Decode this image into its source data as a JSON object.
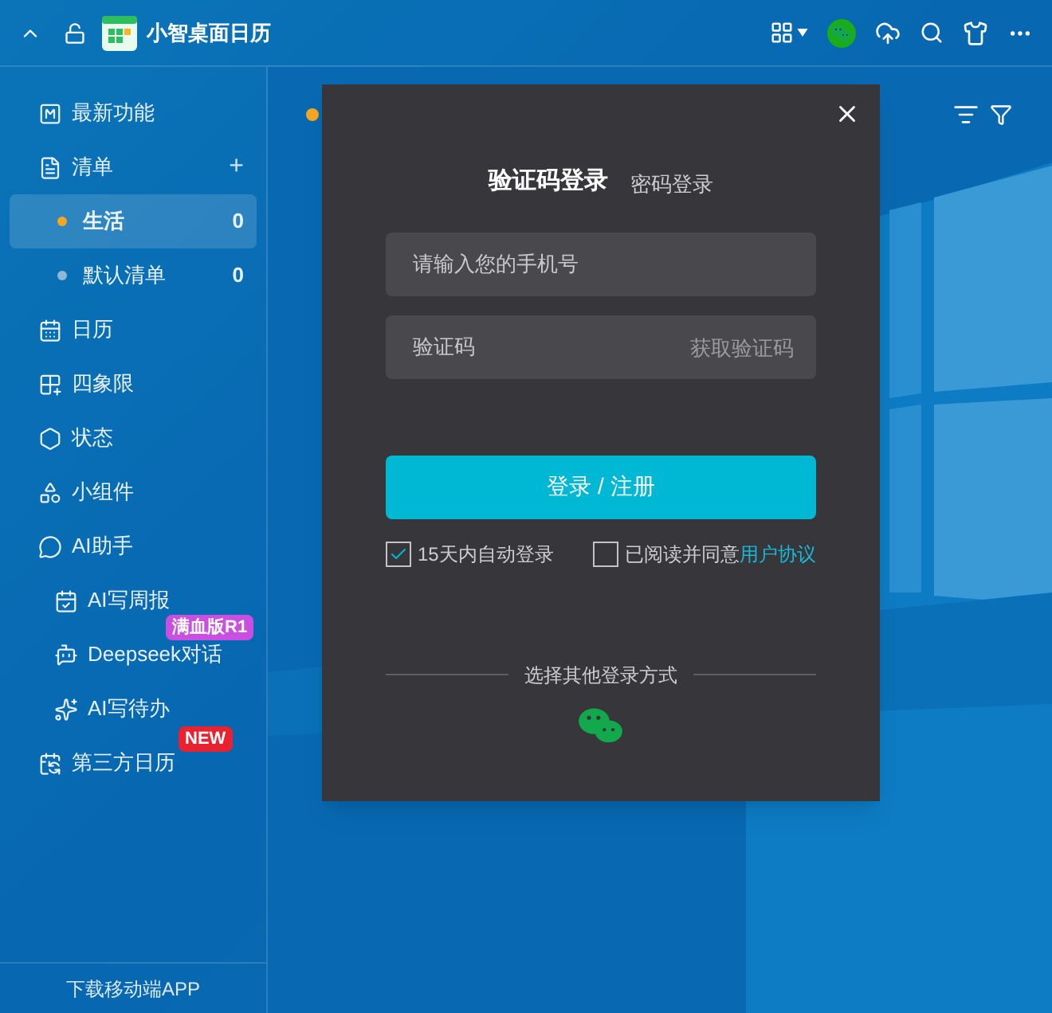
{
  "app": {
    "title": "小智桌面日历"
  },
  "sidebar": {
    "items": [
      {
        "kind": "item",
        "label": "最新功能"
      },
      {
        "kind": "group",
        "label": "清单",
        "add": "+",
        "children": [
          {
            "kind": "list",
            "label": "生活",
            "count": "0",
            "color": "#f5a623",
            "selected": true
          },
          {
            "kind": "list",
            "label": "默认清单",
            "count": "0",
            "color": "#8fb8d8",
            "selected": false
          }
        ]
      },
      {
        "kind": "item",
        "label": "日历"
      },
      {
        "kind": "item",
        "label": "四象限"
      },
      {
        "kind": "item",
        "label": "状态"
      },
      {
        "kind": "item",
        "label": "小组件"
      },
      {
        "kind": "group",
        "label": "AI助手",
        "children": [
          {
            "kind": "sub",
            "label": "AI写周报"
          },
          {
            "kind": "sub",
            "label": "Deepseek对话",
            "badge": "满血版R1",
            "color": "#c84fe0"
          },
          {
            "kind": "sub",
            "label": "AI写待办"
          }
        ]
      },
      {
        "kind": "item",
        "label": "第三方日历",
        "badge": "NEW",
        "color": "#e8222e"
      }
    ],
    "footer": "下载移动端APP"
  },
  "main": {
    "list_dot": {
      "color": "#f5a623"
    }
  },
  "dialog": {
    "tabs": [
      {
        "label": "验证码登录",
        "selected": true
      },
      {
        "label": "密码登录",
        "selected": false
      }
    ],
    "phone": {
      "placeholder": "请输入您的手机号"
    },
    "code": {
      "placeholder": "验证码",
      "action": "获取验证码"
    },
    "submit": "登录 / 注册",
    "options": [
      {
        "label": "15天内自动登录",
        "checked": true
      },
      {
        "label": "已阅读并同意",
        "link": "用户协议",
        "checked": false
      }
    ],
    "other": "选择其他登录方式"
  }
}
